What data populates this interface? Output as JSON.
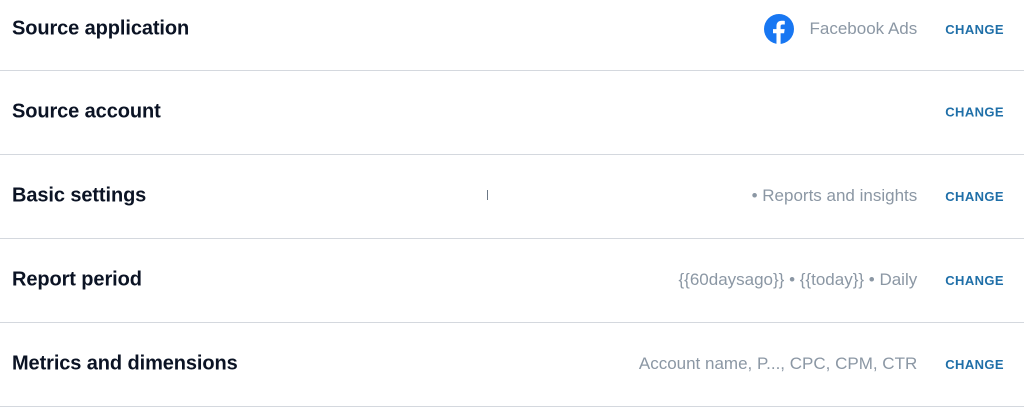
{
  "rows": [
    {
      "label": "Source application",
      "app_icon": "facebook-icon",
      "app_name": "Facebook Ads",
      "change_label": "CHANGE"
    },
    {
      "label": "Source account",
      "change_label": "CHANGE"
    },
    {
      "label": "Basic settings",
      "summary": "• Reports and insights",
      "change_label": "CHANGE"
    },
    {
      "label": "Report period",
      "summary": "{{60daysago}} • {{today}} • Daily",
      "change_label": "CHANGE"
    },
    {
      "label": "Metrics and dimensions",
      "summary": "Account name, P..., CPC, CPM, CTR",
      "change_label": "CHANGE"
    }
  ],
  "colors": {
    "facebook_blue": "#1877F2",
    "change_link": "#1f6fa8",
    "summary_text": "#8b97a4"
  }
}
